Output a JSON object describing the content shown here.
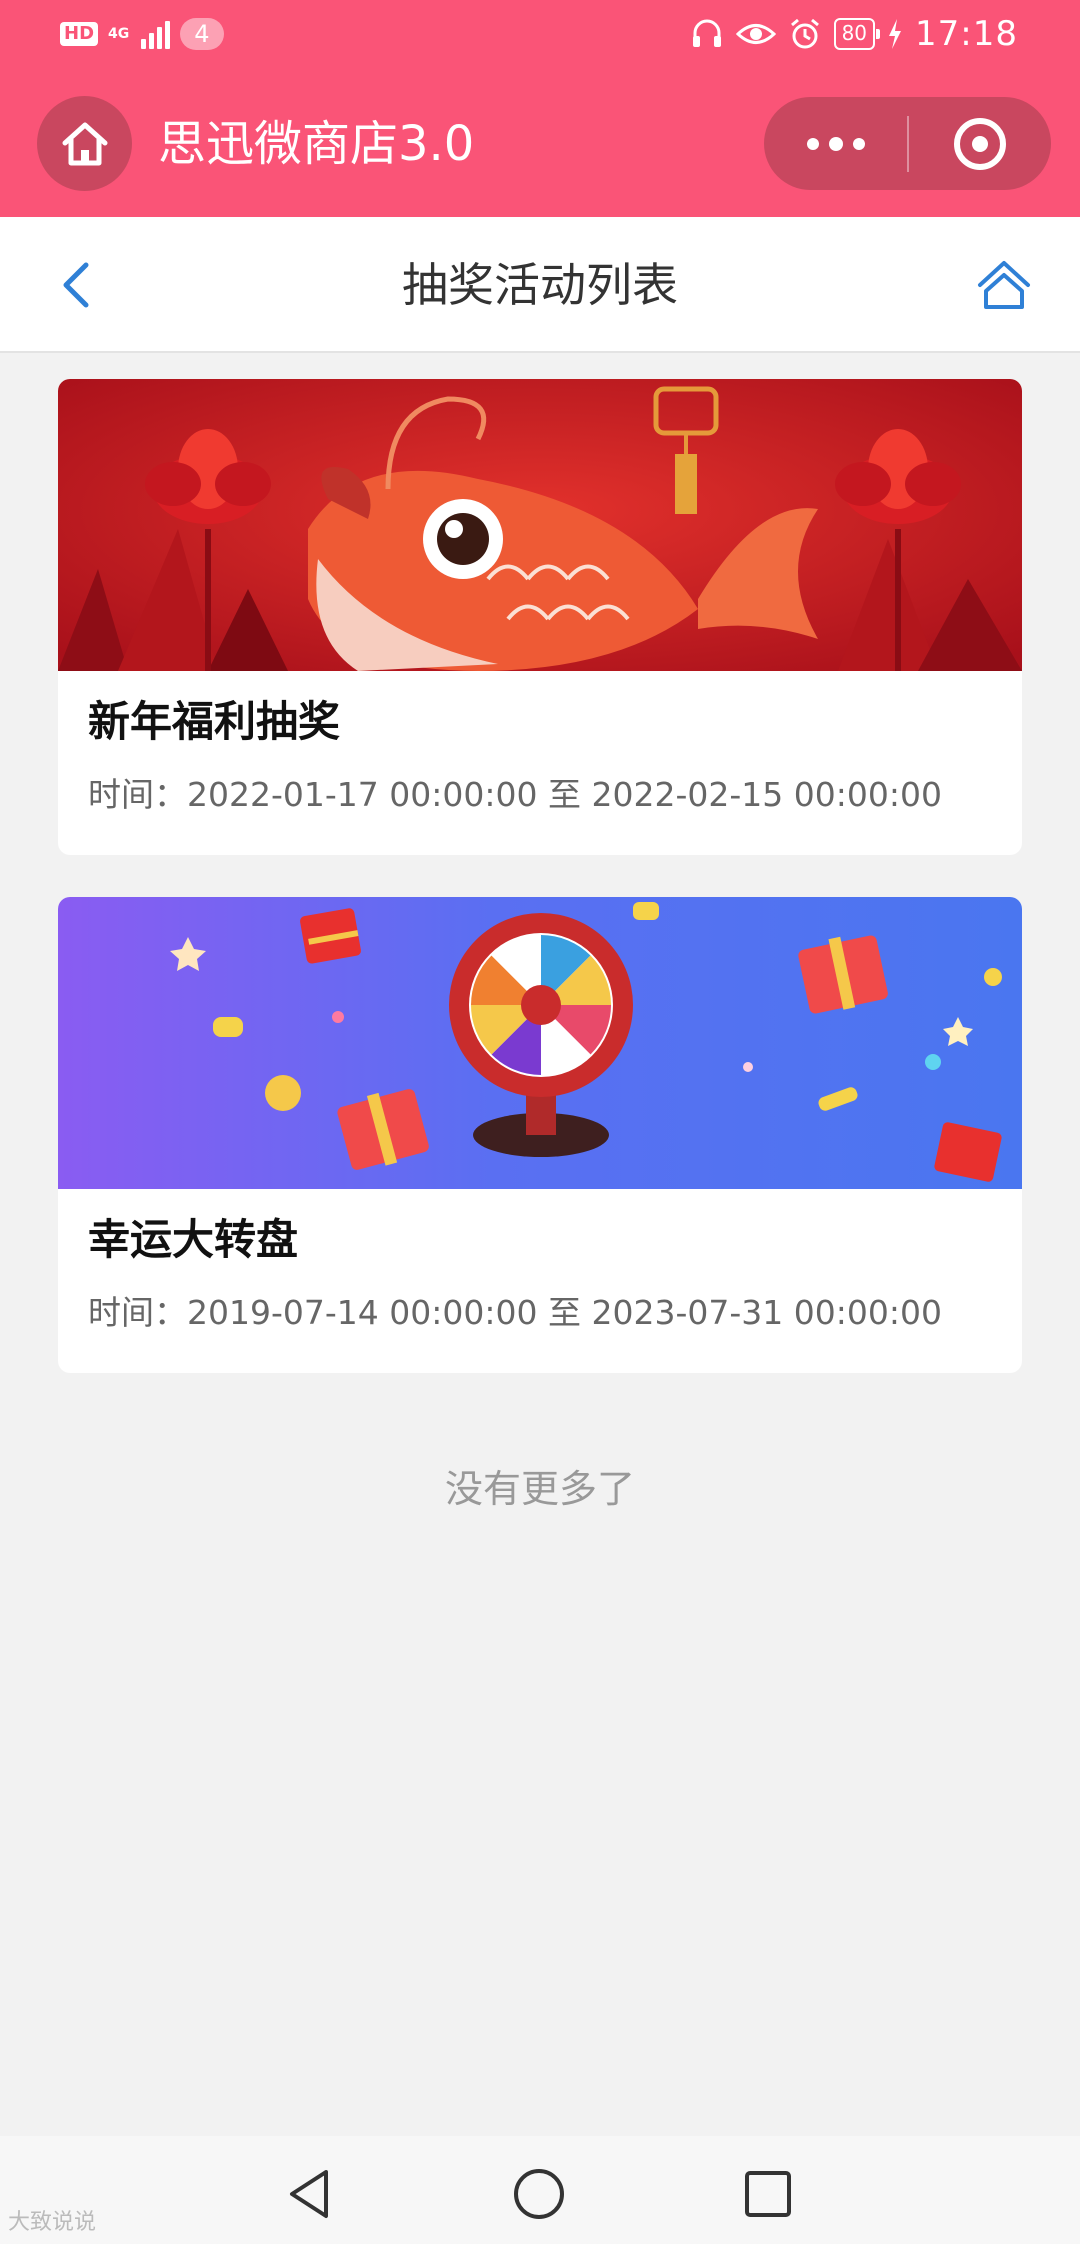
{
  "status_bar": {
    "hd": "HD",
    "network": "4G",
    "badge": "4",
    "battery": "80",
    "time": "17:18"
  },
  "mini_program": {
    "title": "思迅微商店3.0"
  },
  "nav": {
    "title": "抽奖活动列表"
  },
  "activities": [
    {
      "title": "新年福利抽奖",
      "time": "时间：2022-01-17 00:00:00 至 2022-02-15 00:00:00"
    },
    {
      "title": "幸运大转盘",
      "time": "时间：2019-07-14 00:00:00 至 2023-07-31 00:00:00"
    }
  ],
  "footer_text": "没有更多了",
  "watermark": "大致说说",
  "colors": {
    "brand": "#fa5477",
    "brand_dark": "#c9475f",
    "nav_icon": "#2f80d6"
  },
  "icons": {
    "home": "home-icon",
    "more": "more-dots-icon",
    "close": "target-icon",
    "back": "chevron-left-icon",
    "nav_home": "house-outline-icon"
  }
}
